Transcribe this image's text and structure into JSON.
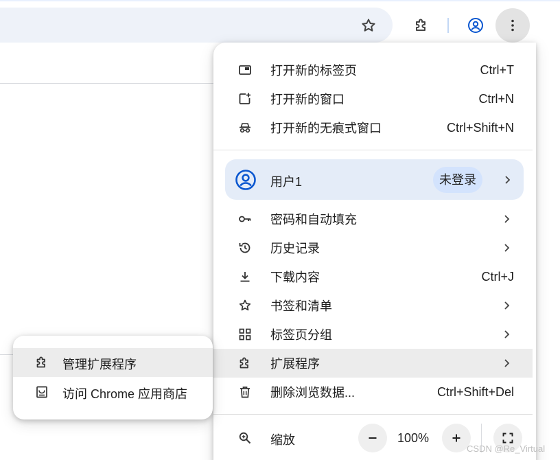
{
  "toolbar": {
    "star_icon": "star-icon",
    "extensions_icon": "puzzle-icon",
    "profile_icon": "account-circle-icon",
    "menu_icon": "more-vert-icon"
  },
  "menu": {
    "items_top": [
      {
        "label": "打开新的标签页",
        "shortcut": "Ctrl+T"
      },
      {
        "label": "打开新的窗口",
        "shortcut": "Ctrl+N"
      },
      {
        "label": "打开新的无痕式窗口",
        "shortcut": "Ctrl+Shift+N"
      }
    ],
    "profile": {
      "name": "用户1",
      "status": "未登录"
    },
    "items_mid": [
      {
        "label": "密码和自动填充",
        "shortcut": ""
      },
      {
        "label": "历史记录",
        "shortcut": ""
      },
      {
        "label": "下载内容",
        "shortcut": "Ctrl+J"
      },
      {
        "label": "书签和清单",
        "shortcut": ""
      },
      {
        "label": "标签页分组",
        "shortcut": ""
      },
      {
        "label": "扩展程序",
        "shortcut": ""
      },
      {
        "label": "删除浏览数据...",
        "shortcut": "Ctrl+Shift+Del"
      }
    ],
    "zoom": {
      "label": "缩放",
      "value": "100%",
      "minus": "−",
      "plus": "+"
    }
  },
  "submenu": {
    "items": [
      {
        "label": "管理扩展程序"
      },
      {
        "label": "访问 Chrome 应用商店"
      }
    ]
  },
  "watermark": "CSDN @Re_Virtual",
  "colors": {
    "accent": "#0b57d0",
    "profile_bg": "#e4ecf8",
    "badge_bg": "#d3e3fd",
    "hover_bg": "#ececec"
  }
}
